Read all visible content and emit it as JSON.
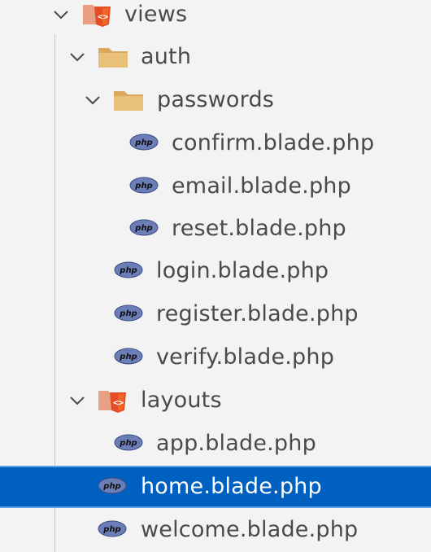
{
  "explorer": {
    "accent_color": "#0060c0",
    "items": [
      {
        "label": "views",
        "icon": "html-folder-icon",
        "expanded": true
      },
      {
        "label": "auth",
        "icon": "folder-icon",
        "expanded": true
      },
      {
        "label": "passwords",
        "icon": "folder-icon",
        "expanded": true
      },
      {
        "label": "confirm.blade.php",
        "icon": "php-file-icon"
      },
      {
        "label": "email.blade.php",
        "icon": "php-file-icon"
      },
      {
        "label": "reset.blade.php",
        "icon": "php-file-icon"
      },
      {
        "label": "login.blade.php",
        "icon": "php-file-icon"
      },
      {
        "label": "register.blade.php",
        "icon": "php-file-icon"
      },
      {
        "label": "verify.blade.php",
        "icon": "php-file-icon"
      },
      {
        "label": "layouts",
        "icon": "html-folder-icon",
        "expanded": true
      },
      {
        "label": "app.blade.php",
        "icon": "php-file-icon"
      },
      {
        "label": "home.blade.php",
        "icon": "php-file-icon",
        "selected": true
      },
      {
        "label": "welcome.blade.php",
        "icon": "php-file-icon"
      }
    ]
  }
}
